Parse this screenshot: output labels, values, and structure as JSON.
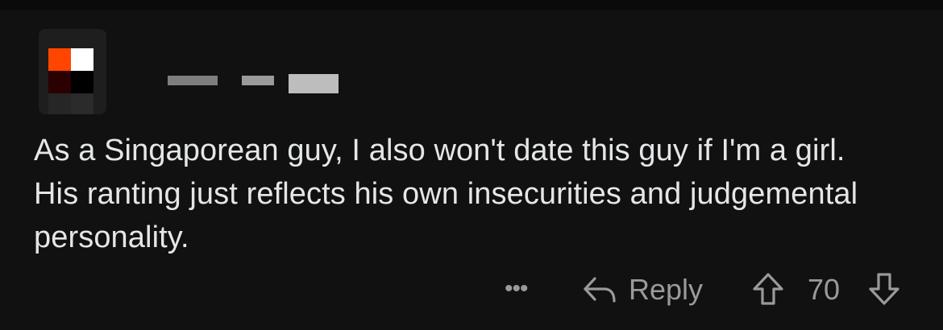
{
  "comment": {
    "author": {
      "avatar_icon": "pixel-avatar-icon",
      "avatar_colors": [
        "#ff4500",
        "#ffffff",
        "#2a0000",
        "#000000",
        "#1e1e1e",
        "#2b2b2b"
      ],
      "username_redacted": true
    },
    "body": "As a Singaporean guy, I also won't date this guy if I'm a girl. His ranting just reflects his own insecurities and judgemental personality.",
    "actions": {
      "more_label": "•••",
      "reply_icon": "reply-arrow-icon",
      "reply_label": "Reply",
      "upvote_icon": "upvote-arrow-icon",
      "score": "70",
      "downvote_icon": "downvote-arrow-icon"
    }
  },
  "theme": {
    "background": "#111111",
    "text": "#e4e6e8",
    "muted": "#9a9a9a"
  }
}
